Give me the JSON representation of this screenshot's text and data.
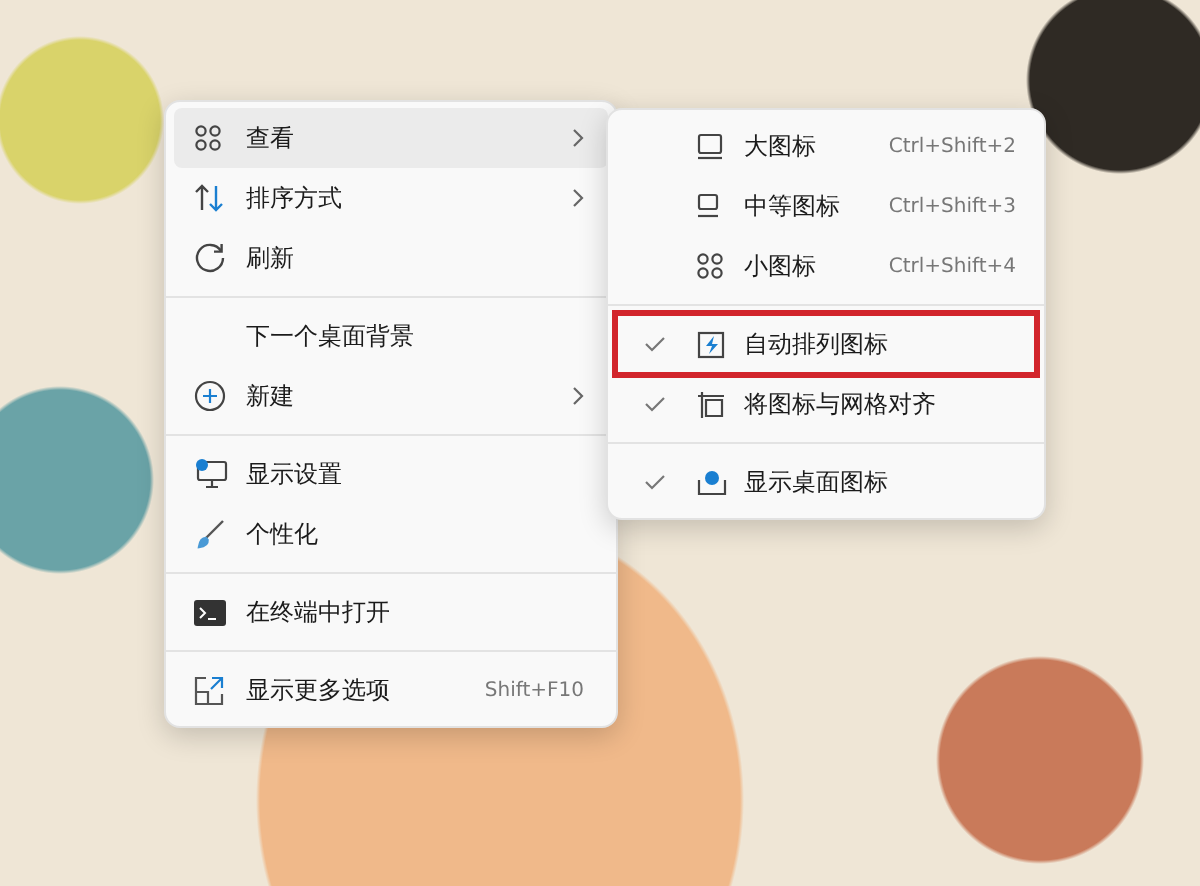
{
  "context_menu": {
    "groups": [
      [
        {
          "label": "查看",
          "submenu": true,
          "selected": true
        },
        {
          "label": "排序方式",
          "submenu": true,
          "selected": false
        },
        {
          "label": "刷新",
          "submenu": false,
          "selected": false
        }
      ],
      [
        {
          "label": "下一个桌面背景",
          "submenu": false,
          "selected": false
        },
        {
          "label": "新建",
          "submenu": true,
          "selected": false
        }
      ],
      [
        {
          "label": "显示设置",
          "submenu": false,
          "selected": false
        },
        {
          "label": "个性化",
          "submenu": false,
          "selected": false
        }
      ],
      [
        {
          "label": "在终端中打开",
          "submenu": false,
          "selected": false
        }
      ],
      [
        {
          "label": "显示更多选项",
          "shortcut": "Shift+F10",
          "submenu": false,
          "selected": false
        }
      ]
    ]
  },
  "view_submenu": {
    "groups": [
      [
        {
          "label": "大图标",
          "shortcut": "Ctrl+Shift+2",
          "checked": false,
          "highlighted": false
        },
        {
          "label": "中等图标",
          "shortcut": "Ctrl+Shift+3",
          "checked": false,
          "highlighted": false
        },
        {
          "label": "小图标",
          "shortcut": "Ctrl+Shift+4",
          "checked": false,
          "highlighted": false
        }
      ],
      [
        {
          "label": "自动排列图标",
          "checked": true,
          "highlighted": true
        },
        {
          "label": "将图标与网格对齐",
          "checked": true,
          "highlighted": false
        }
      ],
      [
        {
          "label": "显示桌面图标",
          "checked": true,
          "highlighted": false
        }
      ]
    ]
  }
}
